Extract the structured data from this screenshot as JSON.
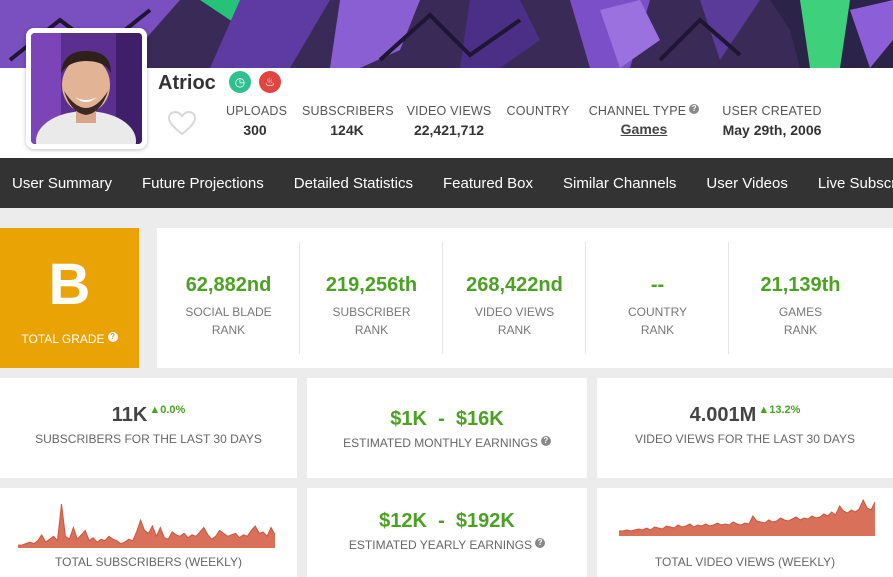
{
  "channel": {
    "name": "Atrioc",
    "badges": [
      "clock-badge-icon",
      "flame-badge-icon"
    ]
  },
  "header_stats": [
    {
      "label": "UPLOADS",
      "value": "300"
    },
    {
      "label": "SUBSCRIBERS",
      "value": "124K"
    },
    {
      "label": "VIDEO VIEWS",
      "value": "22,421,712"
    },
    {
      "label": "COUNTRY",
      "value": ""
    },
    {
      "label": "CHANNEL TYPE",
      "value": "Games"
    },
    {
      "label": "USER CREATED",
      "value": "May 29th, 2006"
    }
  ],
  "nav": [
    "User Summary",
    "Future Projections",
    "Detailed Statistics",
    "Featured Box",
    "Similar Channels",
    "User Videos",
    "Live Subscribe"
  ],
  "grade": {
    "letter": "B",
    "label": "TOTAL GRADE"
  },
  "ranks": [
    {
      "value": "62,882nd",
      "line1": "SOCIAL BLADE",
      "line2": "RANK"
    },
    {
      "value": "219,256th",
      "line1": "SUBSCRIBER",
      "line2": "RANK"
    },
    {
      "value": "268,422nd",
      "line1": "VIDEO VIEWS",
      "line2": "RANK"
    },
    {
      "value": "--",
      "line1": "COUNTRY",
      "line2": "RANK"
    },
    {
      "value": "21,139th",
      "line1": "GAMES",
      "line2": "RANK"
    }
  ],
  "cards": {
    "subs30": {
      "value": "11K",
      "delta": "0.0%",
      "label": "SUBSCRIBERS FOR THE LAST 30 DAYS"
    },
    "monthly": {
      "value": "$1K  -  $16K",
      "label": "ESTIMATED MONTHLY EARNINGS"
    },
    "views30": {
      "value": "4.001M",
      "delta": "13.2%",
      "label": "VIDEO VIEWS FOR THE LAST 30 DAYS"
    },
    "yearly": {
      "value": "$12K  -  $192K",
      "label": "ESTIMATED YEARLY EARNINGS"
    },
    "subs_weekly_label": "TOTAL SUBSCRIBERS (WEEKLY)",
    "views_weekly_label": "TOTAL VIDEO VIEWS (WEEKLY)"
  },
  "colors": {
    "grade_bg": "#e9a305",
    "rank_green": "#4aa122",
    "nav_bg": "#333333",
    "chart_fill": "#d9705a"
  },
  "sparklines": {
    "subs_weekly": [
      2,
      2,
      3,
      4,
      3,
      5,
      9,
      4,
      6,
      8,
      5,
      30,
      8,
      6,
      14,
      6,
      9,
      12,
      5,
      7,
      4,
      6,
      5,
      8,
      6,
      5,
      3,
      4,
      6,
      5,
      11,
      19,
      12,
      10,
      15,
      8,
      14,
      7,
      6,
      11,
      9,
      8,
      10,
      7,
      9,
      8,
      11,
      14,
      9,
      6,
      8,
      12,
      10,
      8,
      9,
      10,
      7,
      9,
      8,
      12,
      15,
      10,
      11,
      8,
      14,
      9
    ],
    "views_weekly": [
      5,
      5,
      6,
      5,
      6,
      7,
      6,
      8,
      6,
      9,
      8,
      7,
      10,
      9,
      8,
      11,
      9,
      10,
      12,
      9,
      11,
      10,
      12,
      10,
      11,
      13,
      11,
      12,
      11,
      14,
      12,
      11,
      13,
      12,
      20,
      15,
      14,
      13,
      16,
      14,
      15,
      18,
      16,
      15,
      17,
      19,
      16,
      18,
      17,
      20,
      18,
      19,
      22,
      20,
      24,
      21,
      30,
      25,
      23,
      26,
      24,
      27,
      36,
      28,
      26,
      34
    ]
  }
}
